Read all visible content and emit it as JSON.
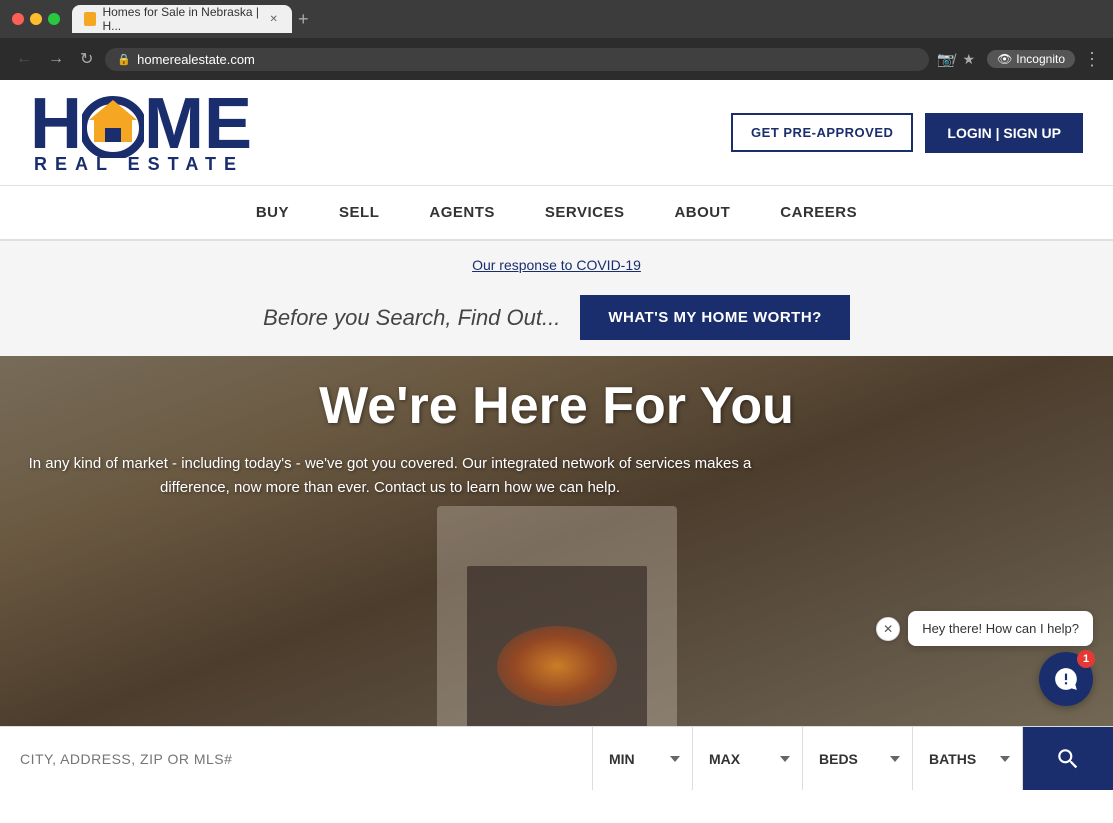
{
  "browser": {
    "tab_title": "Homes for Sale in Nebraska | H...",
    "url": "homerealestate.com",
    "incognito_label": "Incognito"
  },
  "header": {
    "logo_home": "HOME",
    "logo_subtitle": "REAL ESTATE",
    "btn_pre_approved": "GET PRE-APPROVED",
    "btn_login": "LOGIN | SIGN UP"
  },
  "nav": {
    "items": [
      {
        "label": "BUY"
      },
      {
        "label": "SELL"
      },
      {
        "label": "AGENTS"
      },
      {
        "label": "SERVICES"
      },
      {
        "label": "ABOUT"
      },
      {
        "label": "CAREERS"
      }
    ]
  },
  "banner": {
    "covid_link": "Our response to COVID-19",
    "text": "Before you Search, Find Out...",
    "btn_home_worth": "WHAT'S MY HOME WORTH?"
  },
  "hero": {
    "title": "We're Here For You",
    "subtitle": "In any kind of market - including today's - we've got you covered. Our integrated network of services makes a difference, now more than ever. Contact us to learn how we can help."
  },
  "chat": {
    "message": "Hey there! How can I help?",
    "badge": "1"
  },
  "search_bar": {
    "placeholder": "CITY, ADDRESS, ZIP OR MLS#",
    "min_label": "MIN",
    "max_label": "MAX",
    "beds_label": "BEDS",
    "baths_label": "BATHS"
  }
}
